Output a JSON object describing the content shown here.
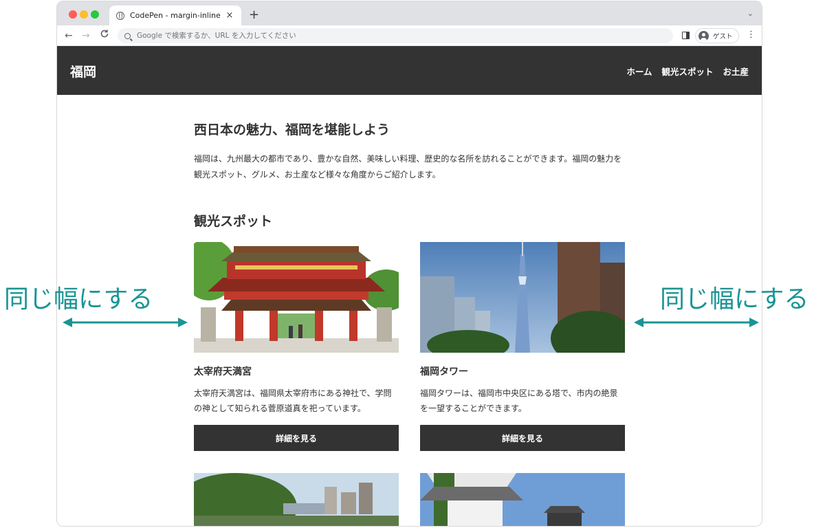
{
  "browser": {
    "tab_title": "CodePen - margin-inline",
    "tab_close": "×",
    "new_tab": "+",
    "tab_menu": "⌄",
    "back": "←",
    "forward": "→",
    "reload": "C",
    "omnibox_placeholder": "Google で検索するか、URL を入力してください",
    "profile_label": "ゲスト",
    "menu": "⋮"
  },
  "site": {
    "brand": "福岡",
    "nav": [
      "ホーム",
      "観光スポット",
      "お土産"
    ],
    "heading": "西日本の魅力、福岡を堪能しよう",
    "intro": "福岡は、九州最大の都市であり、豊かな自然、美味しい料理、歴史的な名所を訪れることができます。福岡の魅力を観光スポット、グルメ、お土産など様々な角度からご紹介します。",
    "section_title": "観光スポット",
    "cards": [
      {
        "title": "太宰府天満宮",
        "description": "太宰府天満宮は、福岡県太宰府市にある神社で、学問の神として知られる菅原道真を祀っています。",
        "button": "詳細を見る"
      },
      {
        "title": "福岡タワー",
        "description": "福岡タワーは、福岡市中央区にある塔で、市内の絶景を一望することができます。",
        "button": "詳細を見る"
      }
    ]
  },
  "annotations": {
    "left_label": "同じ幅にする",
    "right_label": "同じ幅にする",
    "color": "#1a9494"
  },
  "colors": {
    "header_bg": "#333333",
    "button_bg": "#333333",
    "accent": "#1a9494"
  }
}
